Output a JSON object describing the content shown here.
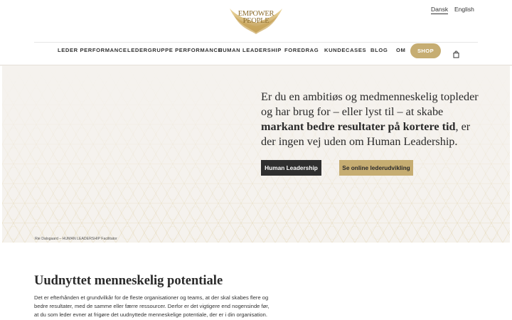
{
  "header": {
    "logo_line1": "EMPOWER",
    "logo_line2": "PEOPLE",
    "languages": {
      "current": "Dansk",
      "other": "English"
    }
  },
  "nav": {
    "items": [
      "LEDER PERFORMANCE",
      "LEDERGRUPPE PERFORMANCE",
      "HUMAN LEADERSHIP",
      "FOREDRAG",
      "KUNDECASES",
      "BLOG",
      "OM"
    ],
    "shop_label": "SHOP"
  },
  "hero": {
    "text_part1": "Er du en ambitiøs og medmenneskelig topleder og har brug for – eller lyst til – at skabe ",
    "text_bold": "markant bedre resultater på kortere tid",
    "text_part2": ", er der ingen vej uden om Human Leadership.",
    "button_primary": "Human Leadership",
    "button_secondary": "Se online lederudvikling",
    "caption": "Rie Dalsgaard – HUMAN LEADERSHIP Facilitator"
  },
  "section": {
    "title": "Uudnyttet menneskelig potentiale",
    "lines": [
      "Det er efterhånden et grundvilkår for de fleste organisationer og teams, at der skal skabes flere og",
      "bedre resultater, med de samme eller færre ressourcer. Derfor er det vigtigere end nogensinde før,",
      "at du som leder evner at frigøre det uudnyttede menneskelige potentiale, der er i din organisation."
    ]
  },
  "colors": {
    "accent_gold": "#c6ad72",
    "dark_button": "#2f2f2f",
    "hero_background": "#f5f2ee"
  },
  "icons": {
    "logo": "golden-wings-logo",
    "cart": "shopping-bag-icon"
  }
}
